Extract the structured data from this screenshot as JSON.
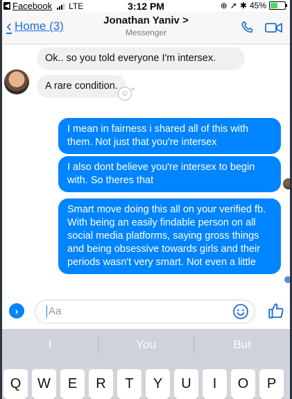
{
  "status_bar": {
    "back_app": "Facebook",
    "carrier": "LTE",
    "time": "3:12 PM",
    "battery": "45%",
    "battery_level": 0.45
  },
  "nav": {
    "back_label": "Home (3)",
    "title": "Jonathan Yaniv >",
    "subtitle": "Messenger"
  },
  "messages": {
    "m1": "Ok.. so you told everyone I'm intersex.",
    "m2": "A rare condition.",
    "m3": "I mean in fairness i shared all of this with them. Not just that you're intersex",
    "m4": "I also dont believe you're intersex to begin with. So theres that",
    "m5": "Smart move doing this all on your verified fb. With being an easily findable person on all social media platforms, saying gross things and being obsessive towards girls and their periods wasn't very smart. Not even a little"
  },
  "composer": {
    "placeholder": "Aa"
  },
  "keyboard": {
    "predictions": [
      "I",
      "You",
      "But"
    ],
    "row1": [
      "Q",
      "W",
      "E",
      "R",
      "T",
      "Y",
      "U",
      "I",
      "O",
      "P"
    ]
  },
  "colors": {
    "accent": "#0084ff",
    "incoming_bubble": "#f0f0f0",
    "keyboard_bg": "#d1d5db"
  }
}
